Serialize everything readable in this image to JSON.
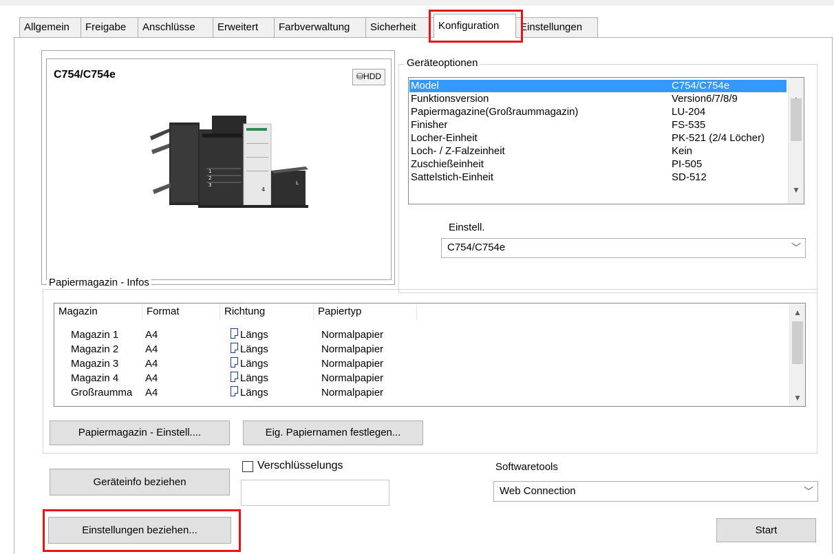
{
  "tabs": [
    {
      "label": "Allgemein"
    },
    {
      "label": "Freigabe"
    },
    {
      "label": "Anschlüsse"
    },
    {
      "label": "Erweitert"
    },
    {
      "label": "Farbverwaltung"
    },
    {
      "label": "Sicherheit"
    },
    {
      "label": "Konfiguration"
    },
    {
      "label": "Einstellungen"
    }
  ],
  "active_tab": "Konfiguration",
  "device": {
    "model_title": "C754/C754e",
    "hdd_badge": "HDD"
  },
  "options": {
    "legend": "Geräteoptionen",
    "rows": [
      {
        "key": "Model",
        "value": "C754/C754e",
        "selected": true
      },
      {
        "key": "Funktionsversion",
        "value": "Version6/7/8/9"
      },
      {
        "key": "Papiermagazine(Großraummagazin)",
        "value": "LU-204"
      },
      {
        "key": "Finisher",
        "value": "FS-535"
      },
      {
        "key": "Locher-Einheit",
        "value": "PK-521 (2/4 Löcher)"
      },
      {
        "key": "Loch- / Z-Falzeinheit",
        "value": "Kein"
      },
      {
        "key": "Zuschießeinheit",
        "value": "PI-505"
      },
      {
        "key": "Sattelstich-Einheit",
        "value": "SD-512"
      }
    ],
    "setting_label": "Einstell.",
    "setting_value": "C754/C754e"
  },
  "paper": {
    "legend": "Papiermagazin - Infos",
    "columns": [
      "Magazin",
      "Format",
      "Richtung",
      "Papiertyp"
    ],
    "rows": [
      {
        "magazin": "Magazin 1",
        "format": "A4",
        "richtung": "Längs",
        "papiertyp": "Normalpapier"
      },
      {
        "magazin": "Magazin 2",
        "format": "A4",
        "richtung": "Längs",
        "papiertyp": "Normalpapier"
      },
      {
        "magazin": "Magazin 3",
        "format": "A4",
        "richtung": "Längs",
        "papiertyp": "Normalpapier"
      },
      {
        "magazin": "Magazin 4",
        "format": "A4",
        "richtung": "Längs",
        "papiertyp": "Normalpapier"
      },
      {
        "magazin": "Großraumma",
        "format": "A4",
        "richtung": "Längs",
        "papiertyp": "Normalpapier"
      }
    ],
    "settings_button": "Papiermagazin - Einstell....",
    "names_button": "Eig. Papiernamen festlegen..."
  },
  "bottom": {
    "device_info_button": "Geräteinfo beziehen",
    "encryption_label": "Verschlüsselungs",
    "encryption_checked": false,
    "softwaretools_label": "Softwaretools",
    "softwaretools_value": "Web Connection",
    "get_settings_button": "Einstellungen beziehen...",
    "start_button": "Start"
  },
  "colors": {
    "selection": "#3399ff",
    "highlight_box": "#e4141b"
  }
}
